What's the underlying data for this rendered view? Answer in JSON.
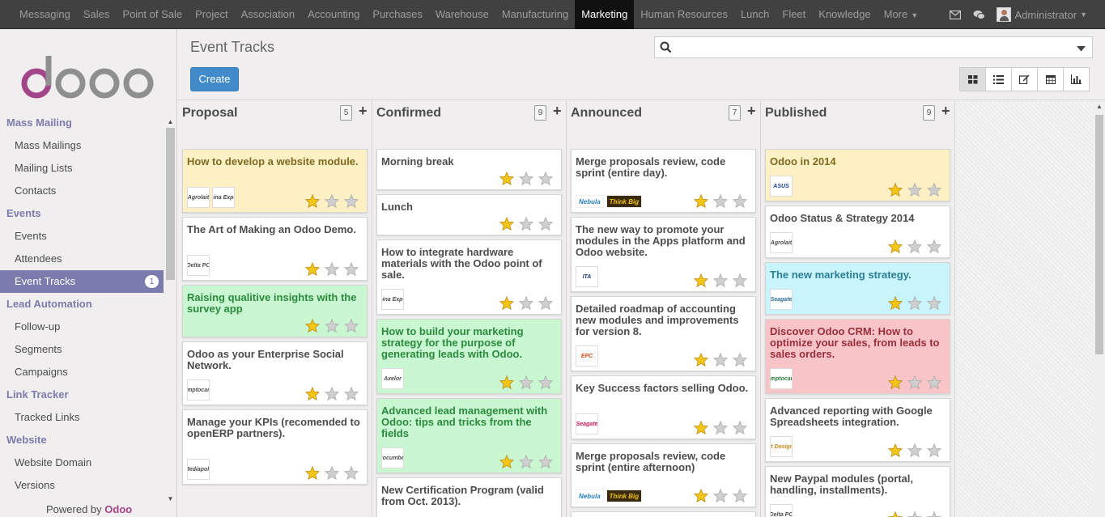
{
  "topbar": {
    "menus": [
      "Messaging",
      "Sales",
      "Point of Sale",
      "Project",
      "Association",
      "Accounting",
      "Purchases",
      "Warehouse",
      "Manufacturing",
      "Marketing",
      "Human Resources",
      "Lunch",
      "Fleet",
      "Knowledge",
      "More"
    ],
    "active": "Marketing",
    "user": "Administrator"
  },
  "sidebar": {
    "sections": [
      {
        "header": "Mass Mailing",
        "items": [
          "Mass Mailings",
          "Mailing Lists",
          "Contacts"
        ]
      },
      {
        "header": "Events",
        "items": [
          "Events",
          "Attendees",
          "Event Tracks"
        ]
      },
      {
        "header": "Lead Automation",
        "items": [
          "Follow-up",
          "Segments",
          "Campaigns"
        ]
      },
      {
        "header": "Link Tracker",
        "items": [
          "Tracked Links"
        ]
      },
      {
        "header": "Website",
        "items": [
          "Website Domain",
          "Versions"
        ]
      }
    ],
    "active_item": "Event Tracks",
    "active_badge": "1",
    "powered_prefix": "Powered by ",
    "powered_brand": "Odoo"
  },
  "control": {
    "title": "Event Tracks",
    "create_label": "Create",
    "search_value": "",
    "views": [
      "kanban",
      "list",
      "form",
      "calendar",
      "graph"
    ],
    "active_view": "kanban"
  },
  "colors": {
    "topbar": "#414141",
    "accent": "#7c7bad",
    "primary_button": "#428bca",
    "star_gold": "#f5c518",
    "card_yellow": "#fcf0c4",
    "card_green": "#c8f7d1",
    "card_cyan": "#c8f5fc",
    "card_red": "#f8c4c8"
  },
  "kanban": {
    "columns": [
      {
        "name": "Proposal",
        "count": "5",
        "cards": [
          {
            "title": "How to develop a website module.",
            "color": "yellow",
            "stars": 1,
            "logos": [
              "Agrolait",
              "China Export"
            ]
          },
          {
            "title": "The Art of Making an Odoo Demo.",
            "color": "white",
            "stars": 1,
            "logos": [
              "Delta PC"
            ]
          },
          {
            "title": "Raising qualitive insights with the survey app",
            "color": "green",
            "stars": 1,
            "logos": []
          },
          {
            "title": "Odoo as your Enterprise Social Network.",
            "color": "white",
            "stars": 1,
            "logos": [
              "camptocamp"
            ]
          },
          {
            "title": "Manage your KPIs (recomended to openERP partners).",
            "color": "white",
            "stars": 1,
            "logos": [
              "Mediapole"
            ]
          }
        ]
      },
      {
        "name": "Confirmed",
        "count": "9",
        "cards": [
          {
            "title": "Morning break",
            "color": "white",
            "stars": 1,
            "logos": []
          },
          {
            "title": "Lunch",
            "color": "white",
            "stars": 1,
            "logos": []
          },
          {
            "title": "How to integrate hardware materials with the Odoo point of sale.",
            "color": "white",
            "stars": 1,
            "logos": [
              "China Export"
            ]
          },
          {
            "title": "How to build your marketing strategy for the purpose of generating leads with Odoo.",
            "color": "green",
            "stars": 1,
            "logos": [
              "Axelor"
            ]
          },
          {
            "title": "Advanced lead management with Odoo: tips and tricks from the fields",
            "color": "green",
            "stars": 1,
            "logos": [
              "Cocumber"
            ]
          },
          {
            "title": "New Certification Program (valid from Oct. 2013).",
            "color": "white",
            "stars": 1,
            "logos": []
          }
        ]
      },
      {
        "name": "Announced",
        "count": "7",
        "cards": [
          {
            "title": "Merge proposals review, code sprint (entire day).",
            "color": "white",
            "stars": 1,
            "logos": [
              "Nebula",
              "Think Big"
            ]
          },
          {
            "title": "The new way to promote your modules in the Apps platform and Odoo website.",
            "color": "white",
            "stars": 1,
            "logos": [
              "ITA"
            ]
          },
          {
            "title": "Detailed roadmap of accounting new modules and improvements for version 8.",
            "color": "white",
            "stars": 1,
            "logos": [
              "EPC"
            ]
          },
          {
            "title": "Key Success factors selling Odoo.",
            "color": "white",
            "stars": 1,
            "logos": [
              "Seagate"
            ]
          },
          {
            "title": "Merge proposals review, code sprint (entire afternoon)",
            "color": "white",
            "stars": 1,
            "logos": [
              "Nebula",
              "Think Big"
            ]
          }
        ]
      },
      {
        "name": "Published",
        "count": "9",
        "cards": [
          {
            "title": "Odoo in 2014",
            "color": "yellow",
            "stars": 1,
            "logos": [
              "ASUS"
            ]
          },
          {
            "title": "Odoo Status & Strategy 2014",
            "color": "white",
            "stars": 1,
            "logos": [
              "Agrolait"
            ]
          },
          {
            "title": "The new marketing strategy.",
            "color": "cyan",
            "stars": 1,
            "logos": [
              "Seagate"
            ]
          },
          {
            "title": "Discover Odoo CRM: How to optimize your sales, from leads to sales orders.",
            "color": "red",
            "stars": 1,
            "logos": [
              "Camptocamp"
            ]
          },
          {
            "title": "Advanced reporting with Google Spreadsheets integration.",
            "color": "white",
            "stars": 1,
            "logos": [
              "Best Designers"
            ]
          },
          {
            "title": "New Paypal modules (portal, handling, installments).",
            "color": "white",
            "stars": 1,
            "logos": [
              "Delta PC"
            ]
          }
        ]
      }
    ]
  }
}
